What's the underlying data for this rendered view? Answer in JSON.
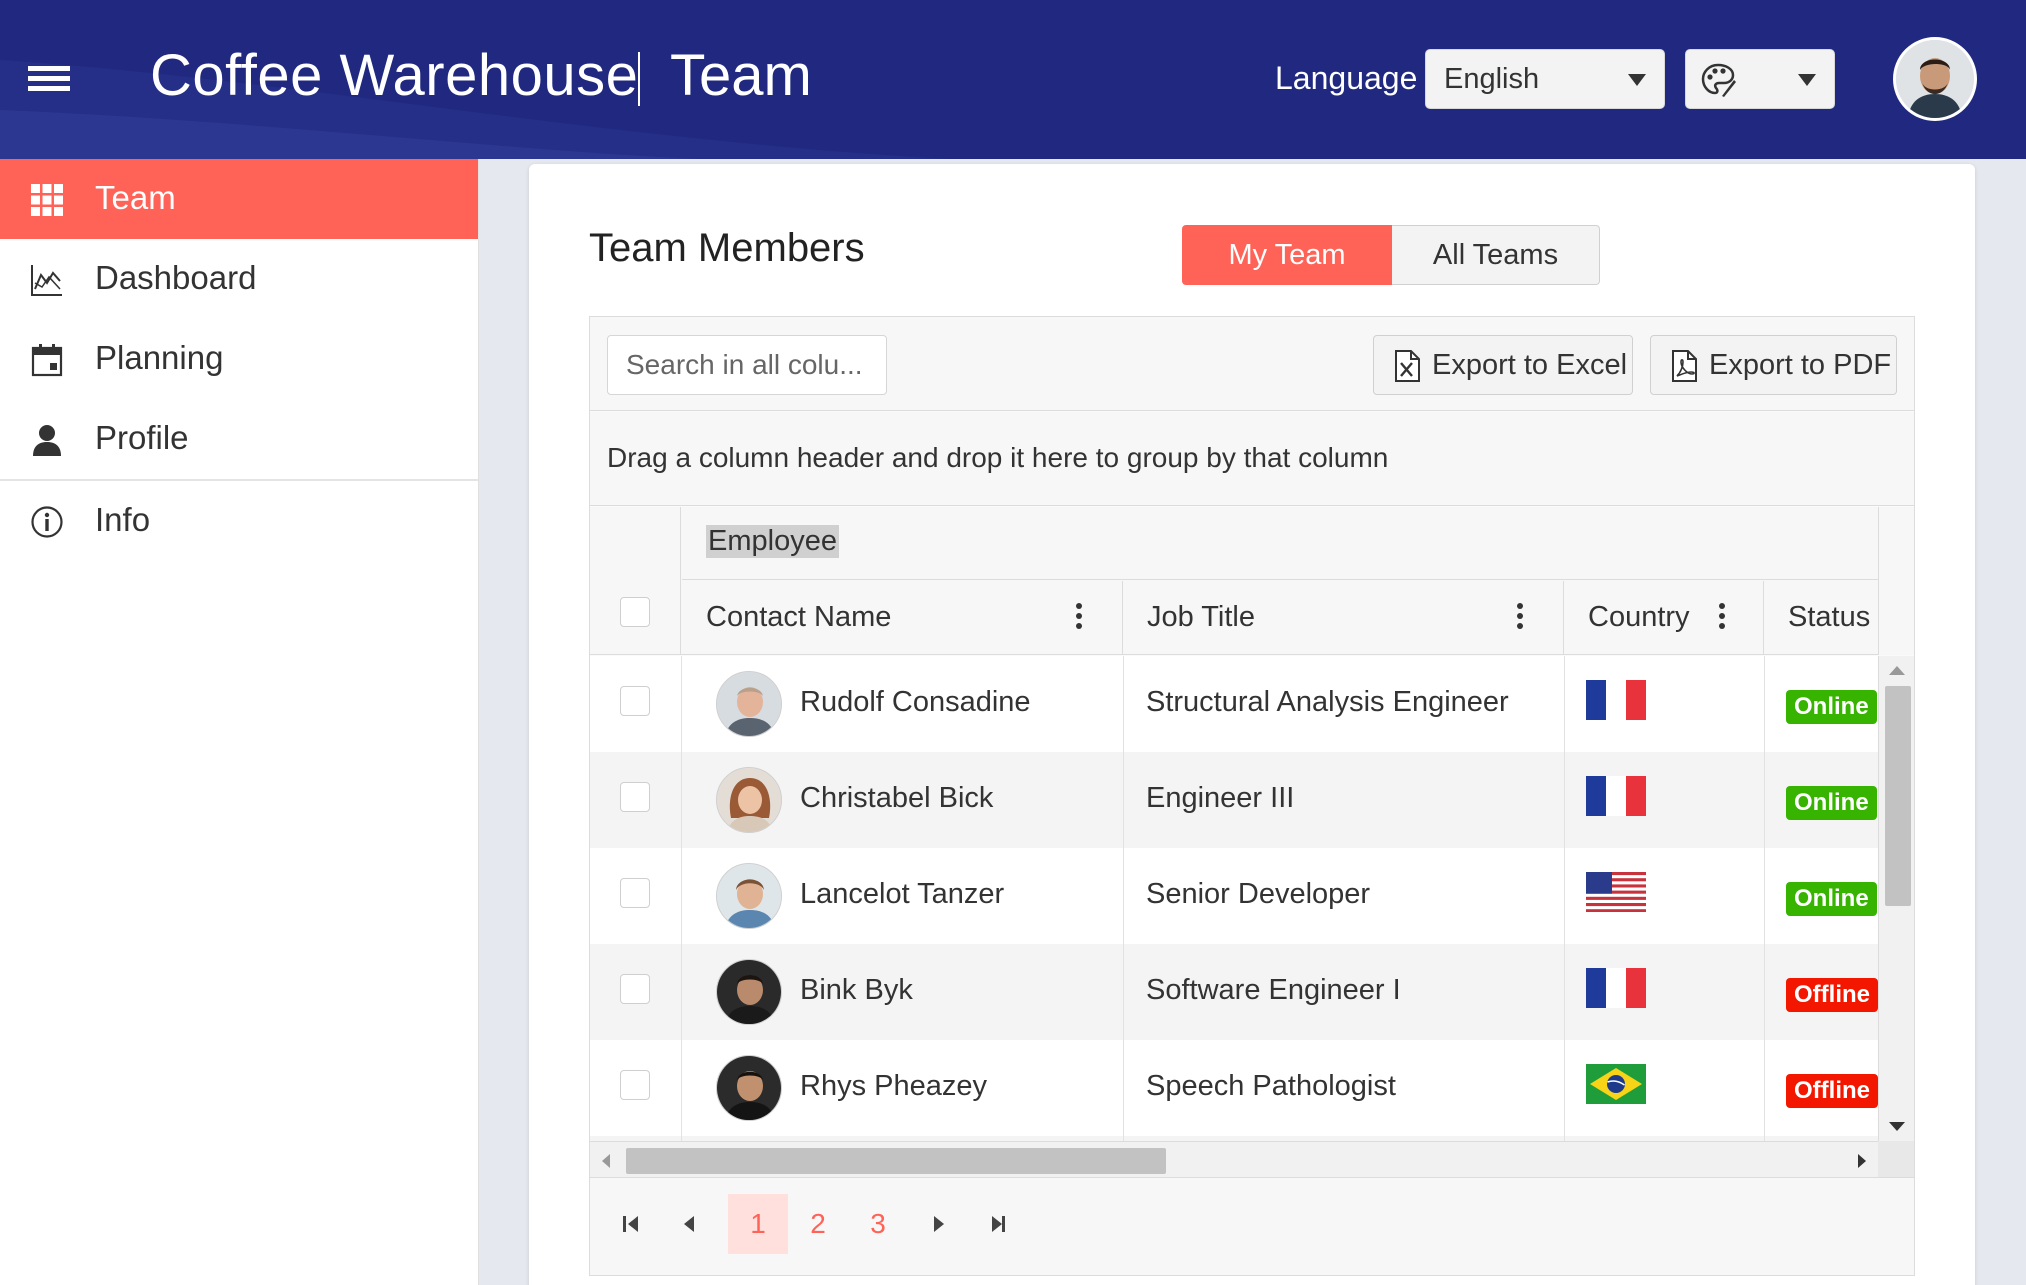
{
  "header": {
    "app_title": "Coffee Warehouse",
    "section_title": "Team",
    "language_label": "Language",
    "language_value": "English",
    "theme_icon": "palette-icon",
    "menu_icon": "hamburger-menu-icon",
    "colors": {
      "header_bg": "#20297f",
      "accent": "#ff6358"
    }
  },
  "sidebar": {
    "items": [
      {
        "label": "Team",
        "icon": "grid-icon",
        "active": true
      },
      {
        "label": "Dashboard",
        "icon": "area-chart-icon",
        "active": false
      },
      {
        "label": "Planning",
        "icon": "calendar-icon",
        "active": false
      },
      {
        "label": "Profile",
        "icon": "user-icon",
        "active": false
      },
      {
        "label": "Info",
        "icon": "info-icon",
        "active": false
      }
    ]
  },
  "main": {
    "title": "Team Members",
    "tabs": [
      {
        "label": "My Team",
        "selected": true
      },
      {
        "label": "All Teams",
        "selected": false
      }
    ],
    "grid": {
      "search_placeholder": "Search in all colu...",
      "export_excel": "Export to Excel",
      "export_pdf": "Export to PDF",
      "group_hint": "Drag a column header and drop it here to group by that column",
      "group_header": "Employee",
      "columns": [
        "Contact Name",
        "Job Title",
        "Country",
        "Status"
      ],
      "rows": [
        {
          "name": "Rudolf Consadine",
          "job": "Structural Analysis Engineer",
          "country": "France",
          "status": "Online"
        },
        {
          "name": "Christabel Bick",
          "job": "Engineer III",
          "country": "France",
          "status": "Online"
        },
        {
          "name": "Lancelot Tanzer",
          "job": "Senior Developer",
          "country": "United States",
          "status": "Online"
        },
        {
          "name": "Bink Byk",
          "job": "Software Engineer I",
          "country": "France",
          "status": "Offline"
        },
        {
          "name": "Rhys Pheazey",
          "job": "Speech Pathologist",
          "country": "Brazil",
          "status": "Offline"
        }
      ],
      "pager": {
        "pages": [
          "1",
          "2",
          "3"
        ],
        "current": "1"
      },
      "status_colors": {
        "online": "#37b400",
        "offline": "#f31700"
      }
    }
  }
}
